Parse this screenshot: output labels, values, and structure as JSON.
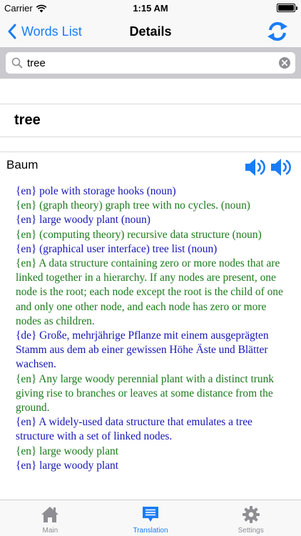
{
  "status_bar": {
    "carrier": "Carrier",
    "time": "1:15 AM",
    "battery_level": 1.0
  },
  "nav_bar": {
    "back_label": "Words List",
    "title": "Details",
    "back_icon": "chevron-left-icon",
    "action_icon": "refresh-arrows-icon"
  },
  "search": {
    "value": "tree",
    "placeholder": ""
  },
  "word": {
    "title": "tree"
  },
  "translation": {
    "word": "Baum",
    "definitions": [
      {
        "text": "{en} pole with storage hooks (noun)",
        "color": "#1616b8"
      },
      {
        "text": "{en} (graph theory) graph tree with no cycles. (noun)",
        "color": "#1a7a1a"
      },
      {
        "text": "{en} large woody plant (noun)",
        "color": "#1616b8"
      },
      {
        "text": "{en} (computing theory) recursive data structure (noun)",
        "color": "#1a7a1a"
      },
      {
        "text": "{en} (graphical user interface) tree list (noun)",
        "color": "#1616b8"
      },
      {
        "text": "{en} A data structure containing zero or more nodes that are linked together in a hierarchy. If any nodes are present, one node is the root; each node except the root is the child of one and only one other node, and each node has zero or more nodes as children.",
        "color": "#1a7a1a"
      },
      {
        "text": "{de} Große, mehrjährige Pflanze mit einem ausgeprägten Stamm aus dem ab einer gewissen Höhe Äste und Blätter wachsen.",
        "color": "#1616b8"
      },
      {
        "text": "{en} Any large woody perennial plant with a distinct trunk giving rise to branches or leaves at some distance from the ground.",
        "color": "#1a7a1a"
      },
      {
        "text": "{en} A widely-used data structure that emulates a tree structure with a set of linked nodes.",
        "color": "#1616b8"
      },
      {
        "text": "{en} large woody plant",
        "color": "#1a7a1a"
      },
      {
        "text": "{en} large woody plant",
        "color": "#1616b8"
      }
    ]
  },
  "tabs": [
    {
      "label": "Main",
      "icon": "home-icon",
      "active": false
    },
    {
      "label": "Translation",
      "icon": "translation-list-icon",
      "active": true
    },
    {
      "label": "Settings",
      "icon": "gear-icon",
      "active": false
    }
  ],
  "colors": {
    "accent": "#1a7cf5",
    "definition_blue": "#1616b8",
    "definition_green": "#1a7a1a",
    "tab_inactive": "#8e8e93"
  }
}
